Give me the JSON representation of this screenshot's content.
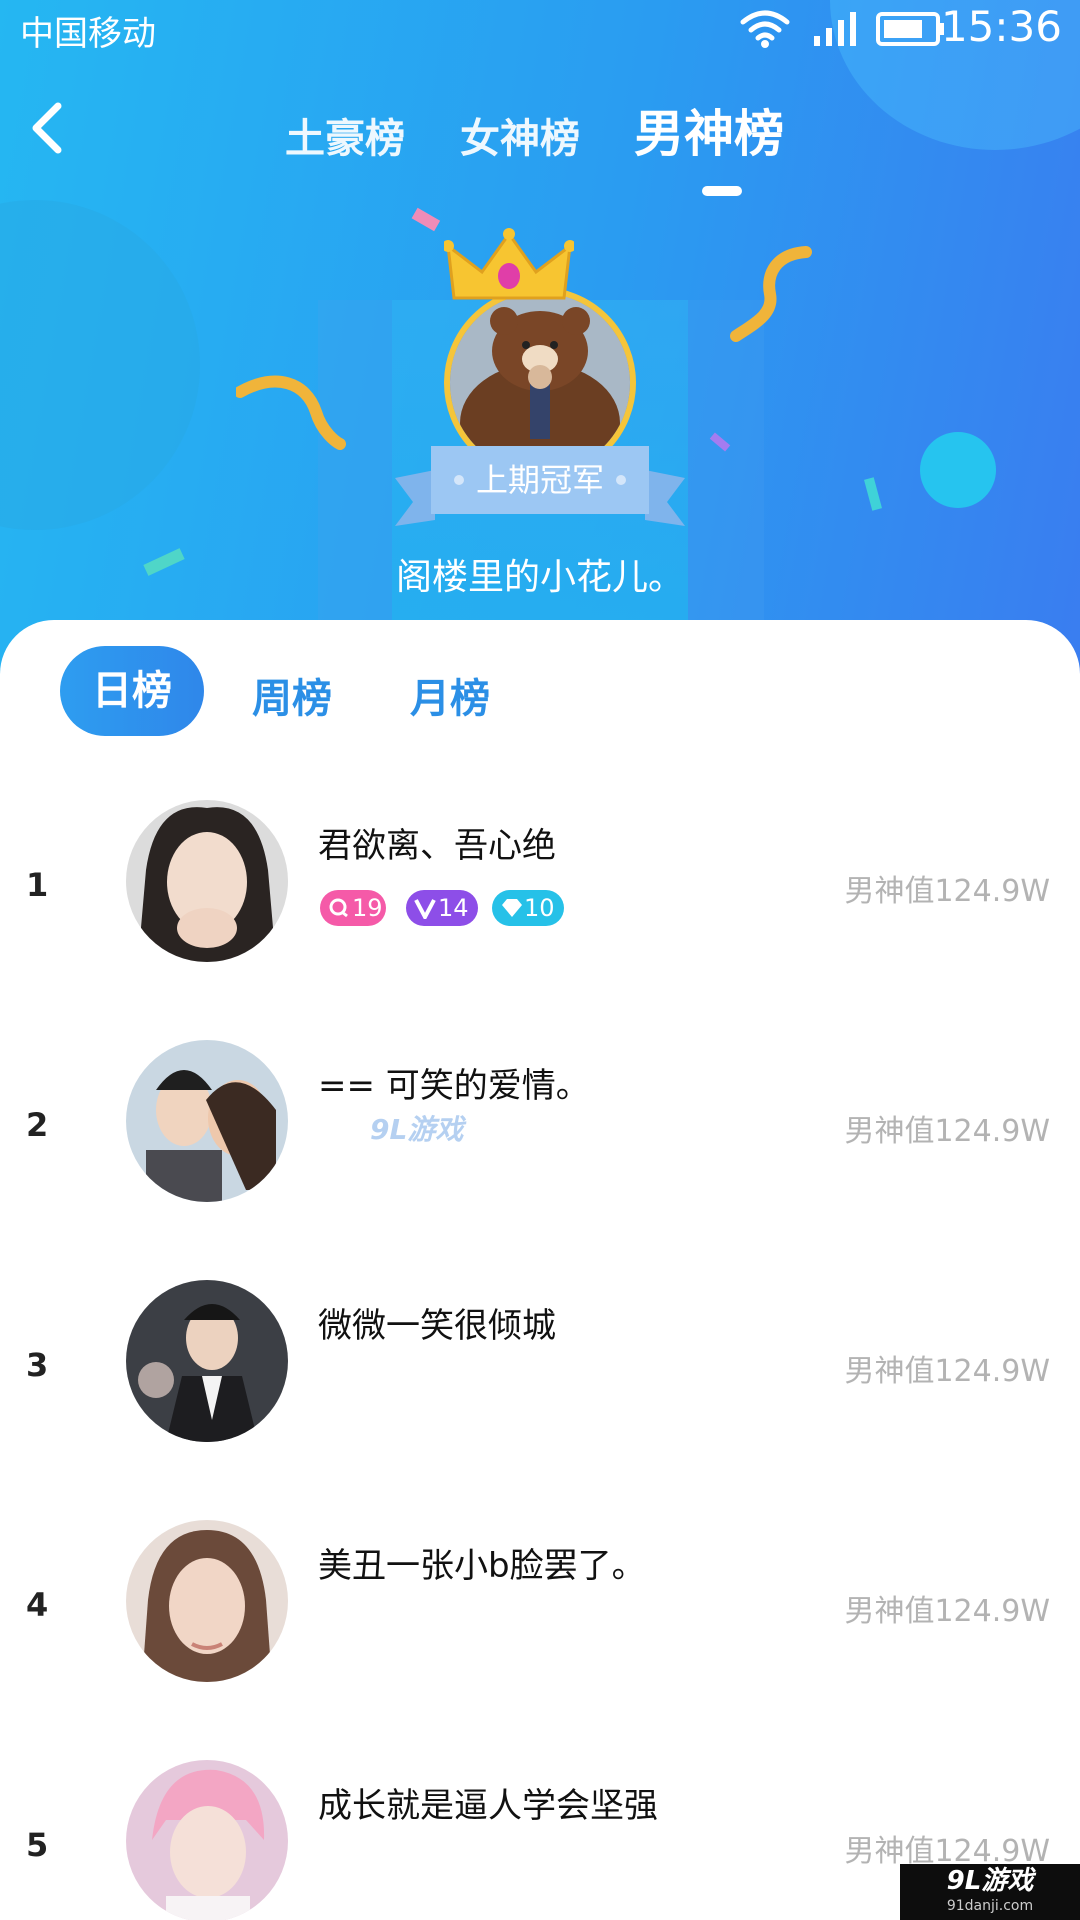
{
  "status_bar": {
    "carrier": "中国移动",
    "time": "15:36"
  },
  "top_tabs": [
    {
      "label": "土豪榜",
      "active": false
    },
    {
      "label": "女神榜",
      "active": false
    },
    {
      "label": "男神榜",
      "active": true
    }
  ],
  "champion": {
    "ribbon_label": "上期冠军",
    "name": "阁楼里的小花儿。"
  },
  "period_tabs": [
    {
      "label": "日榜",
      "active": true
    },
    {
      "label": "周榜",
      "active": false
    },
    {
      "label": "月榜",
      "active": false
    }
  ],
  "rankings": [
    {
      "rank": "1",
      "name": "君欲离、吾心绝",
      "score": "男神值124.9W",
      "badges": [
        {
          "icon": "user-level-icon",
          "value": "19",
          "color": "#f55aa8"
        },
        {
          "icon": "vip-v-icon",
          "value": "14",
          "color": "#8d4ee8"
        },
        {
          "icon": "diamond-icon",
          "value": "10",
          "color": "#26c1e8"
        }
      ]
    },
    {
      "rank": "2",
      "name": "== 可笑的爱情。",
      "score": "男神值124.9W",
      "badges": []
    },
    {
      "rank": "3",
      "name": "微微一笑很倾城",
      "score": "男神值124.9W",
      "badges": []
    },
    {
      "rank": "4",
      "name": "美丑一张小b脸罢了。",
      "score": "男神值124.9W",
      "badges": []
    },
    {
      "rank": "5",
      "name": "成长就是逼人学会坚强",
      "score": "男神值124.9W",
      "badges": []
    }
  ],
  "watermark": {
    "main": "9L游戏",
    "sub": "91danji.com"
  },
  "colors": {
    "accent": "#2e8ff0",
    "header_start": "#25b7f2",
    "header_end": "#3a7df0",
    "score_text": "#b3b3b3"
  }
}
